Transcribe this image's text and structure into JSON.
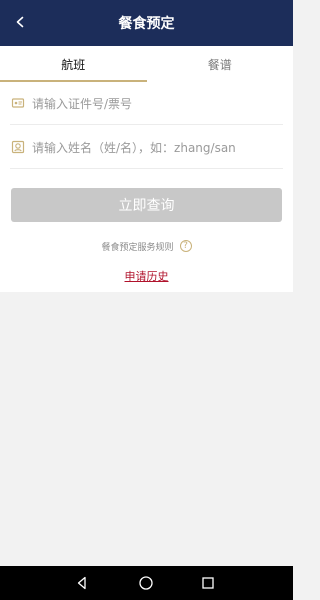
{
  "header": {
    "title": "餐食预定",
    "back_icon": "chevron-left-icon"
  },
  "tabs": [
    {
      "label": "航班",
      "active": true
    },
    {
      "label": "餐谱",
      "active": false
    }
  ],
  "form": {
    "id_placeholder": "请输入证件号/票号",
    "name_placeholder": "请输入姓名（姓/名），如：zhang/san"
  },
  "actions": {
    "query_label": "立即查询"
  },
  "rules": {
    "label": "餐食预定服务规则",
    "help_icon_text": "?"
  },
  "history": {
    "label": "申请历史"
  },
  "colors": {
    "header_bg": "#1c2d5a",
    "accent_gold": "#c9b27b",
    "button_disabled": "#c8c8c8",
    "link_red": "#b0122b"
  },
  "system_nav": {
    "icons": [
      "back-triangle-icon",
      "home-circle-icon",
      "recents-square-icon"
    ]
  }
}
